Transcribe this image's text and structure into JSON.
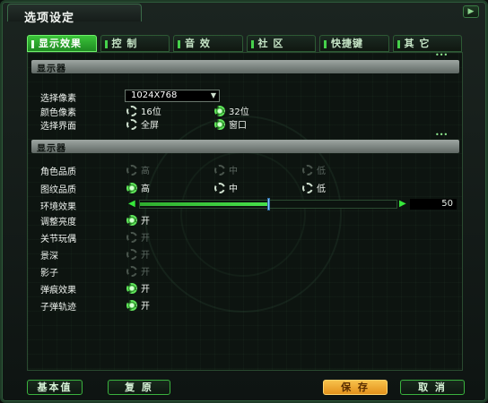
{
  "window": {
    "title": "选项设定",
    "close_label": "▶"
  },
  "tabs": [
    {
      "label": "显示效果",
      "active": true
    },
    {
      "label": "控 制",
      "active": false
    },
    {
      "label": "音 效",
      "active": false
    },
    {
      "label": "社 区",
      "active": false
    },
    {
      "label": "快捷键",
      "active": false
    },
    {
      "label": "其 它",
      "active": false
    }
  ],
  "section1": {
    "title": "显示器",
    "resolution_label": "选择像素",
    "resolution_value": "1024X768",
    "color_label": "颜色像素",
    "color_options": [
      "16位",
      "32位"
    ],
    "color_selected": "32位",
    "screen_label": "选择界面",
    "screen_options": [
      "全屏",
      "窗口"
    ],
    "screen_selected": "窗口"
  },
  "section2": {
    "title": "显示器",
    "character_label": "角色品质",
    "character_options": [
      "高",
      "中",
      "低"
    ],
    "texture_label": "图纹品质",
    "texture_options": [
      "高",
      "中",
      "低"
    ],
    "texture_selected": "高",
    "environment_label": "环境效果",
    "environment_value": "50",
    "environment_percent": 0.5,
    "toggles": [
      {
        "label": "调整亮度",
        "option": "开",
        "on": true
      },
      {
        "label": "关节玩偶",
        "option": "开",
        "on": false
      },
      {
        "label": "景深",
        "option": "开",
        "on": false
      },
      {
        "label": "影子",
        "option": "开",
        "on": false
      },
      {
        "label": "弹痕效果",
        "option": "开",
        "on": true
      },
      {
        "label": "子弹轨迹",
        "option": "开",
        "on": true
      }
    ]
  },
  "footer": {
    "default_label": "基本值",
    "reset_label": "复 原",
    "save_label": "保 存",
    "cancel_label": "取 消"
  },
  "colors": {
    "accent_green": "#3bc43a",
    "save_orange": "#f0a72e"
  }
}
